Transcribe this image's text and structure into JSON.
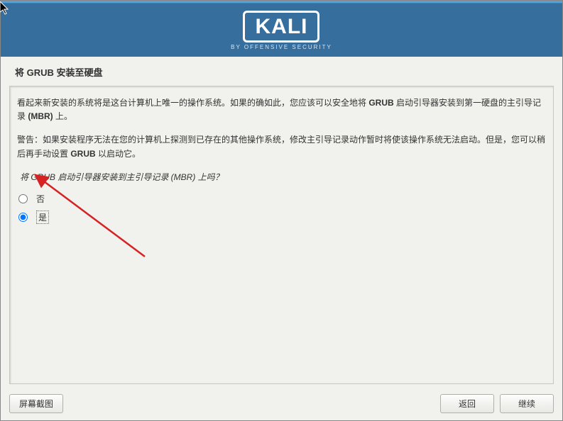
{
  "header": {
    "logo_text": "KALI",
    "logo_subtitle": "BY OFFENSIVE SECURITY"
  },
  "page": {
    "title": "将 GRUB 安装至硬盘"
  },
  "content": {
    "paragraph1_prefix": "看起来新安装的系统将是这台计算机上唯一的操作系统。如果的确如此，您应该可以安全地将 ",
    "paragraph1_bold1": "GRUB",
    "paragraph1_mid": " 启动引导器安装到第一硬盘的主引导记录 ",
    "paragraph1_bold2": "(MBR)",
    "paragraph1_suffix": " 上。",
    "paragraph2_prefix": "警告：如果安装程序无法在您的计算机上探测到已存在的其他操作系统，修改主引导记录动作暂时将使该操作系统无法启动。但是，您可以稍后再手动设置 ",
    "paragraph2_bold": "GRUB",
    "paragraph2_suffix": " 以启动它。",
    "question": "将 GRUB 启动引导器安装到主引导记录 (MBR) 上吗？",
    "option_no": "否",
    "option_yes": "是"
  },
  "footer": {
    "screenshot": "屏幕截图",
    "back": "返回",
    "continue": "继续"
  }
}
